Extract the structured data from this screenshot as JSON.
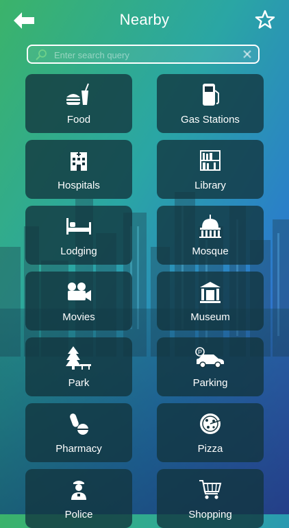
{
  "header": {
    "title": "Nearby"
  },
  "search": {
    "placeholder": "Enter search query",
    "value": ""
  },
  "categories": [
    {
      "label": "Food",
      "icon": "food-icon"
    },
    {
      "label": "Gas Stations",
      "icon": "gas-station-icon"
    },
    {
      "label": "Hospitals",
      "icon": "hospital-icon"
    },
    {
      "label": "Library",
      "icon": "library-icon"
    },
    {
      "label": "Lodging",
      "icon": "bed-icon"
    },
    {
      "label": "Mosque",
      "icon": "mosque-icon"
    },
    {
      "label": "Movies",
      "icon": "movie-camera-icon"
    },
    {
      "label": "Museum",
      "icon": "museum-icon"
    },
    {
      "label": "Park",
      "icon": "tree-icon"
    },
    {
      "label": "Parking",
      "icon": "parking-car-icon"
    },
    {
      "label": "Pharmacy",
      "icon": "pills-icon"
    },
    {
      "label": "Pizza",
      "icon": "pizza-icon"
    },
    {
      "label": "Police",
      "icon": "police-icon"
    },
    {
      "label": "Shopping",
      "icon": "shopping-cart-icon"
    }
  ]
}
